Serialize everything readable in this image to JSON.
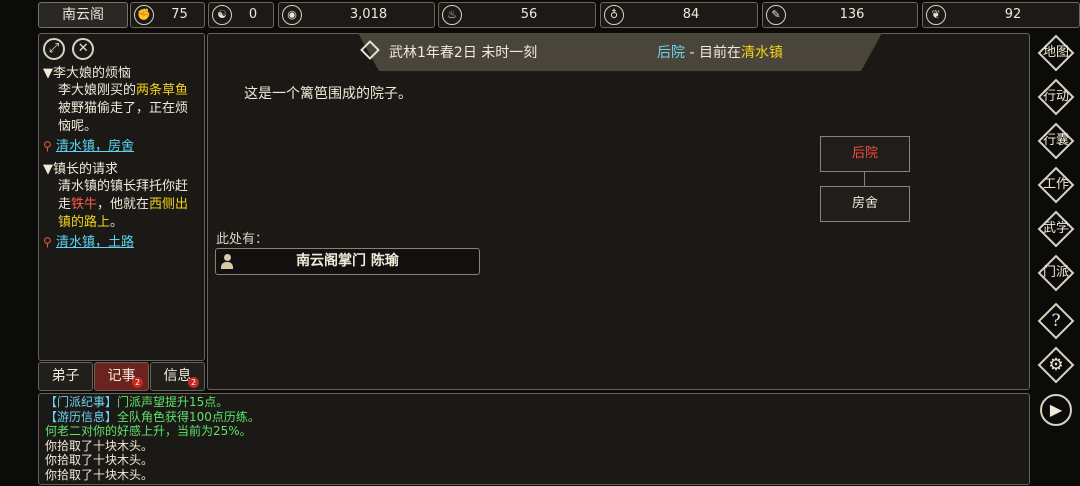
{
  "topbar": {
    "sect_name": "南云阁",
    "resources": [
      {
        "icon": "fist-icon",
        "glyph": "✊",
        "value": "75"
      },
      {
        "icon": "yinyang-icon",
        "glyph": "☯",
        "value": "0"
      },
      {
        "icon": "coin-icon",
        "glyph": "◉",
        "value": "3,018"
      },
      {
        "icon": "food-bowl-icon",
        "glyph": "♨",
        "value": "56"
      },
      {
        "icon": "gourd-icon",
        "glyph": "♁",
        "value": "84"
      },
      {
        "icon": "wood-icon",
        "glyph": "✎",
        "value": "136"
      },
      {
        "icon": "herb-icon",
        "glyph": "❦",
        "value": "92"
      }
    ]
  },
  "quests": {
    "expand_glyph": "⤢",
    "close_glyph": "✕",
    "items": [
      {
        "title": "▼李大娘的烦恼",
        "body_parts": [
          "李大娘刚买的",
          "两条草鱼",
          "被野猫偷走了，正在烦恼呢。"
        ],
        "location": "清水镇，房舍"
      },
      {
        "title": "▼镇长的请求",
        "body_parts": [
          "清水镇的镇长拜托你赶走",
          "铁牛",
          "，他就在",
          "西侧出镇的路上",
          "。"
        ],
        "location": "清水镇，土路"
      }
    ]
  },
  "tabs": [
    {
      "label": "弟子",
      "badge": ""
    },
    {
      "label": "记事",
      "badge": "2"
    },
    {
      "label": "信息",
      "badge": "2"
    }
  ],
  "header": {
    "date": "武林1年春2日 未时一刻",
    "place": "后院",
    "sep": " - 目前在",
    "town": "清水镇"
  },
  "scene": {
    "description": "这是一个篱笆围成的院子。",
    "map_current": "后院",
    "map_next": "房舍",
    "here_label": "此处有：",
    "npc": "南云阁掌门 陈瑜"
  },
  "log": [
    {
      "tag": "【门派纪事】",
      "text": "门派声望提升15点。"
    },
    {
      "tag": "【游历信息】",
      "text": "全队角色获得100点历练。"
    },
    {
      "tag": "",
      "text": "何老二对你的好感上升，当前为25%。"
    },
    {
      "tag": "",
      "text": "你拾取了十块木头。"
    },
    {
      "tag": "",
      "text": "你拾取了十块木头。"
    },
    {
      "tag": "",
      "text": "你拾取了十块木头。"
    }
  ],
  "sidebar": [
    {
      "label": "地图",
      "icon": "map-icon"
    },
    {
      "label": "行动",
      "icon": "action-icon"
    },
    {
      "label": "行囊",
      "icon": "bag-icon"
    },
    {
      "label": "工作",
      "icon": "work-icon"
    },
    {
      "label": "武学",
      "icon": "martial-icon"
    },
    {
      "label": "门派",
      "icon": "sect-icon"
    },
    {
      "label": "?",
      "icon": "help-icon"
    },
    {
      "label": "⚙",
      "icon": "gear-icon"
    },
    {
      "label": "▶",
      "icon": "play-icon"
    }
  ]
}
